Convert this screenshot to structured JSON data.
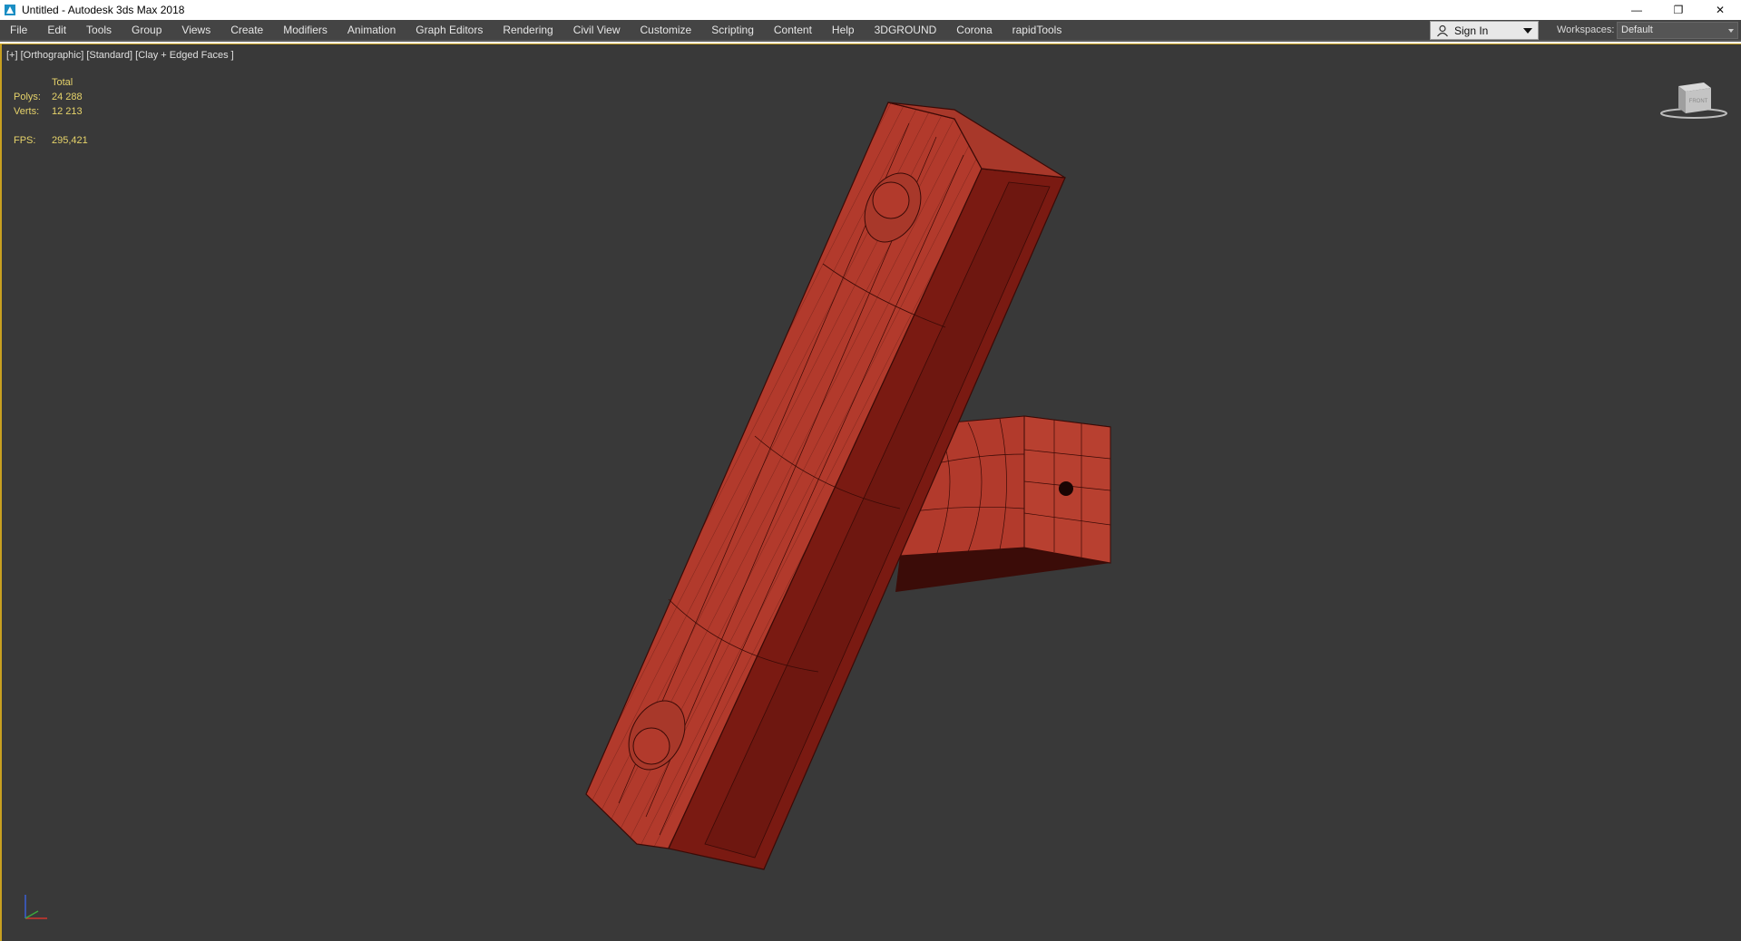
{
  "window": {
    "title": "Untitled - Autodesk 3ds Max 2018",
    "controls": {
      "minimize": "—",
      "restore": "❐",
      "close": "✕"
    }
  },
  "menubar": {
    "items": [
      "File",
      "Edit",
      "Tools",
      "Group",
      "Views",
      "Create",
      "Modifiers",
      "Animation",
      "Graph Editors",
      "Rendering",
      "Civil View",
      "Customize",
      "Scripting",
      "Content",
      "Help",
      "3DGROUND",
      "Corona",
      "rapidTools"
    ],
    "signin_label": "Sign In",
    "workspaces_label": "Workspaces:",
    "workspace_value": "Default"
  },
  "viewport": {
    "label": "[+] [Orthographic] [Standard] [Clay + Edged Faces ]",
    "stats": {
      "total_label": "Total",
      "polys_label": "Polys:",
      "polys_value": "24 288",
      "verts_label": "Verts:",
      "verts_value": "12 213",
      "fps_label": "FPS:",
      "fps_value": "295,421"
    },
    "viewcube": {
      "front_label": "FRONT",
      "top_label": "TOP"
    }
  },
  "colors": {
    "menubar_bg": "#444444",
    "viewport_bg": "#393939",
    "stats_text": "#e6d36a",
    "model_fill": "#b23a2c",
    "model_dark": "#6e1710",
    "wire": "#3a0a06",
    "viewport_border": "#c8a020"
  }
}
